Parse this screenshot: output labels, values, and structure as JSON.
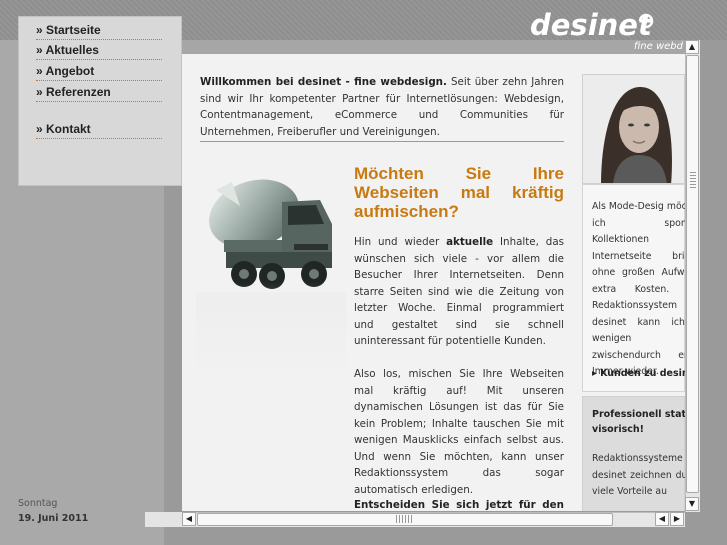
{
  "brand": {
    "logo_text": "desinet",
    "tagline": "fine webd"
  },
  "nav": {
    "items": [
      {
        "label": "» Startseite"
      },
      {
        "label": "» Aktuelles"
      },
      {
        "label": "» Angebot"
      },
      {
        "label": "» Referenzen"
      },
      {
        "label": "» Kontakt"
      }
    ]
  },
  "main": {
    "intro_bold": "Willkommen bei desinet - fine webdesign.",
    "intro_text": " Seit über zehn Jahren sind wir Ihr kompetenter Partner für Internetlösungen: Webdesign, Contentmanagement, eCommerce und Communities für Unternehmen, Freiberufler und Vereinigungen.",
    "headline": "Möchten Sie Ihre Webseiten mal kräftig aufmischen?",
    "para1_a": "Hin und wieder ",
    "para1_bold": "aktuelle",
    "para1_b": " Inhalte, das wünschen sich viele - vor allem die Besucher Ihrer Internetseiten. Denn starre Seiten sind wie die Zeitung von letzter Woche. Einmal programmiert und gestaltet sind sie schnell uninteressant für potentielle Kunden.",
    "para2": "Also los, mischen Sie Ihre Webseiten mal kräftig auf! Mit unseren dynamischen Lösungen ist das für Sie kein Problem; Inhalte tauschen Sie mit wenigen Mausklicks einfach selbst aus. Und wenn Sie möchten, kann unser Redaktionssystem das sogar automatisch erledigen.",
    "cta_line": "Entscheiden Sie sich jetzt für den"
  },
  "sidebar": {
    "panel1_text": "Als Mode-Desig möchte ich spontan Kollektionen auf Internetseite bringe ohne großen Aufwand extra Kosten. Mit Redaktionssystem desinet kann ich d wenigen Mi zwischendurch erled Immer wieder.",
    "panel1_link": "Kunden zu desine",
    "panel2_head": "Professionell statt visorisch!",
    "panel2_text": "Redaktionssysteme desinet zeichnen durch viele Vorteile au"
  },
  "footer": {
    "day": "Sonntag",
    "date": "19. Juni 2011"
  },
  "scroll": {
    "up": "▲",
    "down": "▼",
    "left": "◀",
    "right": "▶"
  }
}
